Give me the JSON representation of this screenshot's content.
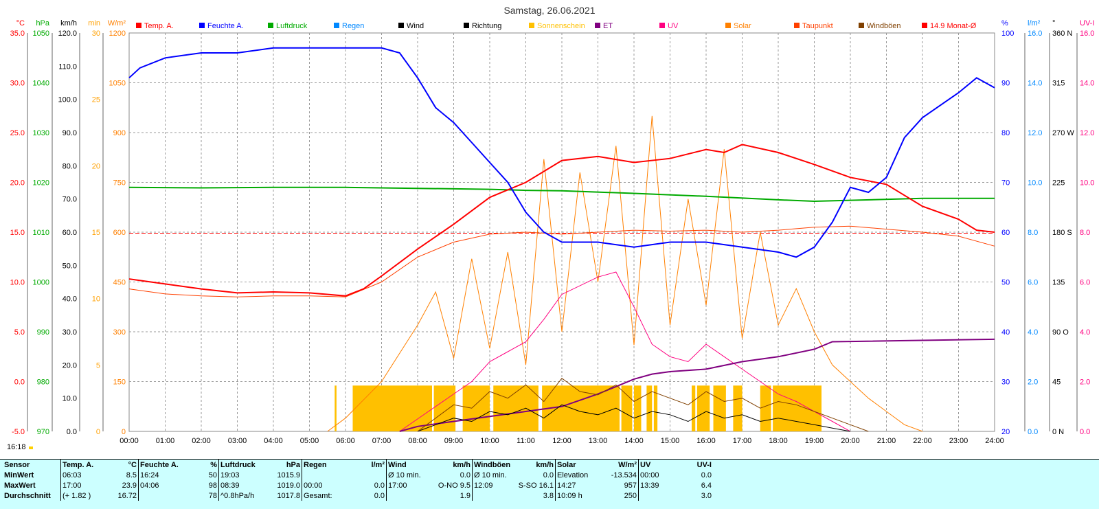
{
  "chart_data": {
    "type": "line",
    "title": "Samstag, 26.06.2021",
    "time_label": "16:18",
    "x_ticks": [
      "00:00",
      "01:00",
      "02:00",
      "03:00",
      "04:00",
      "05:00",
      "06:00",
      "07:00",
      "08:00",
      "09:00",
      "10:00",
      "11:00",
      "12:00",
      "13:00",
      "14:00",
      "15:00",
      "16:00",
      "17:00",
      "18:00",
      "19:00",
      "20:00",
      "21:00",
      "22:00",
      "23:00",
      "24:00"
    ],
    "legend": [
      {
        "name": "Temp. A.",
        "color": "#ff0000"
      },
      {
        "name": "Feuchte A.",
        "color": "#0000ff"
      },
      {
        "name": "Luftdruck",
        "color": "#00aa00"
      },
      {
        "name": "Regen",
        "color": "#0088ff"
      },
      {
        "name": "Wind",
        "color": "#000000"
      },
      {
        "name": "Richtung",
        "color": "#000000"
      },
      {
        "name": "Sonnenschein",
        "color": "#ffc000"
      },
      {
        "name": "ET",
        "color": "#800080"
      },
      {
        "name": "UV",
        "color": "#ff0080"
      },
      {
        "name": "Solar",
        "color": "#ff8000"
      },
      {
        "name": "Taupunkt",
        "color": "#ff4000"
      },
      {
        "name": "Windböen",
        "color": "#804000"
      },
      {
        "name": "14.9 Monat-Ø",
        "color": "#ff0000"
      }
    ],
    "axes": {
      "temp": {
        "unit": "°C",
        "ticks": [
          "35.0",
          "30.0",
          "25.0",
          "20.0",
          "15.0",
          "10.0",
          "5.0",
          "0.0",
          "-5.0"
        ],
        "color": "#ff0000",
        "ylim": [
          -5,
          35
        ]
      },
      "pressure": {
        "unit": "hPa",
        "ticks": [
          "1050",
          "1040",
          "1030",
          "1020",
          "1010",
          "1000",
          "990",
          "980",
          "970"
        ],
        "color": "#00aa00",
        "ylim": [
          970,
          1050
        ]
      },
      "wind": {
        "unit": "km/h",
        "ticks": [
          "120.0",
          "110.0",
          "100.0",
          "90.0",
          "80.0",
          "70.0",
          "60.0",
          "50.0",
          "40.0",
          "30.0",
          "20.0",
          "10.0",
          "0.0"
        ],
        "color": "#000000",
        "ylim": [
          0,
          120
        ]
      },
      "sunshine": {
        "unit": "min",
        "ticks": [
          "30",
          "25",
          "20",
          "15",
          "10",
          "5",
          "0"
        ],
        "color": "#ffa000",
        "ylim": [
          0,
          30
        ]
      },
      "solar": {
        "unit": "W/m²",
        "ticks": [
          "1200",
          "1050",
          "900",
          "750",
          "600",
          "450",
          "300",
          "150",
          "0"
        ],
        "color": "#ff8000",
        "ylim": [
          0,
          1200
        ]
      },
      "humidity": {
        "unit": "%",
        "ticks": [
          "100",
          "90",
          "80",
          "70",
          "60",
          "50",
          "40",
          "30",
          "20"
        ],
        "color": "#0000ff",
        "ylim": [
          20,
          100
        ]
      },
      "rain": {
        "unit": "l/m²",
        "ticks": [
          "16.0",
          "14.0",
          "12.0",
          "10.0",
          "8.0",
          "6.0",
          "4.0",
          "2.0",
          "0.0"
        ],
        "color": "#0088ff",
        "ylim": [
          0,
          16
        ]
      },
      "direction": {
        "unit": "°",
        "ticks": [
          "360 N",
          "315",
          "270 W",
          "225",
          "180 S",
          "135",
          "90 O",
          "45",
          "0 N"
        ],
        "color": "#000000",
        "ylim": [
          0,
          360
        ]
      },
      "uv": {
        "unit": "UV-I",
        "ticks": [
          "16.0",
          "14.0",
          "12.0",
          "10.0",
          "8.0",
          "6.0",
          "4.0",
          "2.0",
          "0.0"
        ],
        "color": "#ff0080",
        "ylim": [
          0,
          16
        ]
      }
    },
    "series": [
      {
        "name": "Temp. A.",
        "axis": "temp",
        "color": "#ff0000",
        "x": [
          0,
          1,
          2,
          3,
          4,
          5,
          6,
          6.5,
          7,
          8,
          9,
          10,
          11,
          12,
          13,
          14,
          15,
          16,
          16.5,
          17,
          18,
          19,
          20,
          21,
          22,
          23,
          23.5,
          24
        ],
        "y": [
          10.3,
          9.8,
          9.3,
          8.9,
          9.0,
          8.9,
          8.6,
          9.3,
          10.6,
          13.3,
          15.8,
          18.5,
          20.0,
          22.2,
          22.6,
          22.0,
          22.4,
          23.3,
          23.0,
          23.8,
          23.0,
          21.8,
          20.5,
          19.8,
          17.6,
          16.3,
          15.2,
          15.0
        ]
      },
      {
        "name": "Taupunkt",
        "axis": "temp",
        "color": "#ff4000",
        "x": [
          0,
          1,
          2,
          3,
          4,
          5,
          6,
          7,
          8,
          9,
          10,
          11,
          12,
          13,
          14,
          15,
          16,
          17,
          18,
          19,
          20,
          21,
          22,
          23,
          24
        ],
        "y": [
          9.3,
          8.8,
          8.6,
          8.5,
          8.6,
          8.6,
          8.5,
          10.0,
          12.5,
          14.0,
          14.8,
          15.0,
          14.8,
          15.0,
          15.2,
          15.1,
          15.2,
          15.0,
          15.2,
          15.5,
          15.6,
          15.3,
          15.0,
          14.6,
          13.6
        ]
      },
      {
        "name": "Feuchte A.",
        "axis": "humidity",
        "color": "#0000ff",
        "x": [
          0,
          0.3,
          1,
          2,
          3,
          4,
          5,
          6,
          7,
          7.5,
          8,
          8.5,
          9,
          9.5,
          10,
          10.5,
          11,
          11.5,
          12,
          13,
          14,
          15,
          16,
          17,
          18,
          18.5,
          19,
          19.5,
          20,
          20.5,
          21,
          21.5,
          22,
          23,
          23.5,
          24
        ],
        "y": [
          91,
          93,
          95,
          96,
          96,
          97,
          97,
          97,
          97,
          96,
          91,
          85,
          82,
          78,
          74,
          70,
          64,
          60,
          58,
          58,
          57,
          58,
          58,
          57,
          56,
          55,
          57,
          62,
          69,
          68,
          71,
          79,
          83,
          88,
          91,
          89
        ]
      },
      {
        "name": "Luftdruck",
        "axis": "pressure",
        "color": "#00aa00",
        "x": [
          0,
          2,
          4,
          6,
          8,
          10,
          11,
          12,
          14,
          16,
          18,
          19,
          20,
          22,
          24
        ],
        "y": [
          1019.0,
          1018.9,
          1019.0,
          1019.0,
          1018.8,
          1018.6,
          1018.4,
          1018.3,
          1017.8,
          1017.2,
          1016.5,
          1016.2,
          1016.4,
          1016.8,
          1016.8
        ]
      },
      {
        "name": "Solar",
        "axis": "solar",
        "color": "#ff8000",
        "x": [
          5.5,
          6,
          7,
          8,
          8.5,
          9,
          9.5,
          10,
          10.5,
          11,
          11.5,
          12,
          12.5,
          13,
          13.5,
          14,
          14.5,
          15,
          15.5,
          16,
          16.5,
          17,
          17.5,
          18,
          18.5,
          19,
          19.5,
          20,
          20.5,
          21,
          21.5,
          22
        ],
        "y": [
          0,
          40,
          150,
          320,
          420,
          220,
          520,
          250,
          540,
          200,
          820,
          300,
          780,
          450,
          860,
          260,
          950,
          320,
          700,
          380,
          850,
          280,
          600,
          320,
          430,
          300,
          200,
          150,
          100,
          60,
          20,
          0
        ]
      },
      {
        "name": "UV",
        "axis": "uv",
        "color": "#ff0080",
        "x": [
          7.5,
          8,
          9,
          9.5,
          10,
          10.5,
          11,
          11.5,
          12,
          13,
          13.5,
          14,
          14.5,
          15,
          15.5,
          16,
          16.5,
          17,
          17.5,
          18,
          18.5,
          19,
          19.5,
          20
        ],
        "y": [
          0,
          0.5,
          1.5,
          2.0,
          2.8,
          3.2,
          3.6,
          4.5,
          5.5,
          6.2,
          6.4,
          5.0,
          3.5,
          3.0,
          2.8,
          3.5,
          3.0,
          2.5,
          2.0,
          1.5,
          1.2,
          0.8,
          0.4,
          0
        ]
      },
      {
        "name": "ET",
        "axis": "rain",
        "color": "#800080",
        "x": [
          7.5,
          8,
          9,
          10,
          11,
          12,
          13,
          13.5,
          14,
          14.5,
          15,
          16,
          17,
          18,
          19,
          19.5,
          24
        ],
        "y": [
          0,
          0.2,
          0.4,
          0.6,
          0.8,
          1.0,
          1.5,
          1.8,
          2.1,
          2.3,
          2.4,
          2.5,
          2.8,
          3.0,
          3.3,
          3.6,
          3.7
        ]
      },
      {
        "name": "Wind",
        "axis": "wind",
        "color": "#000000",
        "x": [
          8,
          8.5,
          9,
          9.5,
          10,
          10.5,
          11,
          11.5,
          12,
          12.5,
          13,
          13.5,
          14,
          14.5,
          15,
          15.5,
          16,
          16.5,
          17,
          17.5,
          18,
          18.5,
          19,
          19.5,
          20
        ],
        "y": [
          0,
          2,
          4,
          3,
          6,
          5,
          7,
          4,
          8,
          6,
          5,
          7,
          4,
          6,
          5,
          3,
          6,
          4,
          5,
          3,
          4,
          3,
          2,
          1,
          0
        ]
      },
      {
        "name": "Windböen",
        "axis": "wind",
        "color": "#804000",
        "x": [
          8,
          8.5,
          9,
          9.5,
          10,
          10.5,
          11,
          11.5,
          12,
          12.5,
          13,
          13.5,
          14,
          14.5,
          15,
          15.5,
          16,
          16.5,
          17,
          17.5,
          18,
          18.5,
          19,
          19.5,
          20,
          20.5
        ],
        "y": [
          0,
          4,
          8,
          7,
          12,
          10,
          14,
          9,
          16,
          12,
          11,
          14,
          9,
          12,
          10,
          8,
          12,
          9,
          10,
          7,
          9,
          8,
          6,
          4,
          2,
          0
        ]
      }
    ],
    "sunshine_blocks": [
      [
        5.7,
        5.75
      ],
      [
        6.2,
        8.4
      ],
      [
        8.45,
        9.05
      ],
      [
        9.25,
        10.0
      ],
      [
        10.1,
        11.35
      ],
      [
        11.45,
        13.6
      ],
      [
        13.65,
        13.95
      ],
      [
        14.0,
        14.2
      ],
      [
        14.35,
        14.5
      ],
      [
        14.55,
        14.65
      ],
      [
        15.6,
        15.7
      ],
      [
        15.75,
        16.1
      ],
      [
        16.2,
        16.55
      ],
      [
        16.75,
        17.0
      ],
      [
        17.5,
        17.8
      ],
      [
        17.85,
        19.2
      ]
    ],
    "month_avg_temp": 14.9
  },
  "stats": {
    "headers": [
      "Sensor",
      "Temp. A.",
      "°C",
      "Feuchte A.",
      "%",
      "Luftdruck",
      "hPa",
      "Regen",
      "l/m²",
      "Wind",
      "km/h",
      "Windböen",
      "km/h",
      "Solar",
      "W/m²",
      "UV",
      "UV-I"
    ],
    "rows": [
      {
        "label": "MinWert",
        "temp_time": "06:03",
        "temp": "8.5",
        "hum_time": "16:24",
        "hum": "50",
        "press_time": "19:03",
        "press": "1015.9",
        "rain_time": "",
        "rain": "",
        "wind_label": "Ø 10 min.",
        "wind": "0.0",
        "gust_label": "Ø 10 min.",
        "gust": "0.0",
        "solar_label": "Elevation",
        "solar": "-13.534",
        "uv_time": "00:00",
        "uv": "0.0"
      },
      {
        "label": "MaxWert",
        "temp_time": "17:00",
        "temp": "23.9",
        "hum_time": "04:06",
        "hum": "98",
        "press_time": "08:39",
        "press": "1019.0",
        "rain_time": "00:00",
        "rain": "0.0",
        "wind_label": "17:00",
        "wind": "O-NO 9.5",
        "gust_label": "12:09",
        "gust": "S-SO 16.1",
        "solar_label": "14:27",
        "solar": "957",
        "uv_time": "13:39",
        "uv": "6.4"
      },
      {
        "label": "Durchschnitt",
        "temp_time": "(+ 1.82 )",
        "temp": "16.72",
        "hum_time": "",
        "hum": "78",
        "press_time": "^0.8hPa/h",
        "press": "1017.8",
        "rain_time": "Gesamt:",
        "rain": "0.0",
        "wind_label": "",
        "wind": "1.9",
        "gust_label": "",
        "gust": "3.8",
        "solar_label": "10:09 h",
        "solar": "250",
        "uv_time": "",
        "uv": "3.0"
      }
    ]
  }
}
